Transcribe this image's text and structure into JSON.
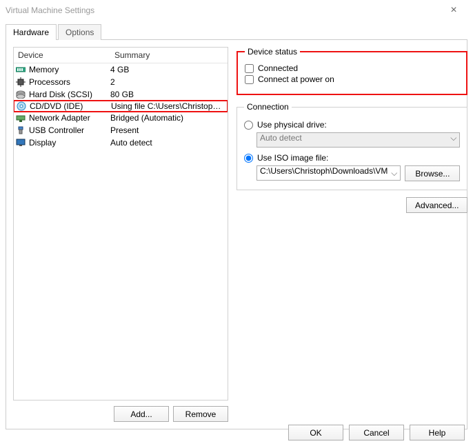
{
  "window": {
    "title": "Virtual Machine Settings"
  },
  "tabs": {
    "hardware": "Hardware",
    "options": "Options",
    "active": "hardware"
  },
  "columns": {
    "device": "Device",
    "summary": "Summary"
  },
  "devices": [
    {
      "name": "Memory",
      "summary": "4 GB"
    },
    {
      "name": "Processors",
      "summary": "2"
    },
    {
      "name": "Hard Disk (SCSI)",
      "summary": "80 GB"
    },
    {
      "name": "CD/DVD (IDE)",
      "summary": "Using file C:\\Users\\Christoph\\D..."
    },
    {
      "name": "Network Adapter",
      "summary": "Bridged (Automatic)"
    },
    {
      "name": "USB Controller",
      "summary": "Present"
    },
    {
      "name": "Display",
      "summary": "Auto detect"
    }
  ],
  "selected_device_index": 3,
  "buttons": {
    "add": "Add...",
    "remove": "Remove",
    "browse": "Browse...",
    "advanced": "Advanced...",
    "ok": "OK",
    "cancel": "Cancel",
    "help": "Help"
  },
  "status": {
    "legend": "Device status",
    "connected": {
      "label": "Connected",
      "checked": false
    },
    "connect_poweron": {
      "label": "Connect at power on",
      "checked": false
    }
  },
  "connection": {
    "legend": "Connection",
    "physical": {
      "label": "Use physical drive:",
      "selected": false,
      "dropdown": "Auto detect",
      "disabled": true
    },
    "iso": {
      "label": "Use ISO image file:",
      "selected": true,
      "path": "C:\\Users\\Christoph\\Downloads\\VM"
    }
  }
}
